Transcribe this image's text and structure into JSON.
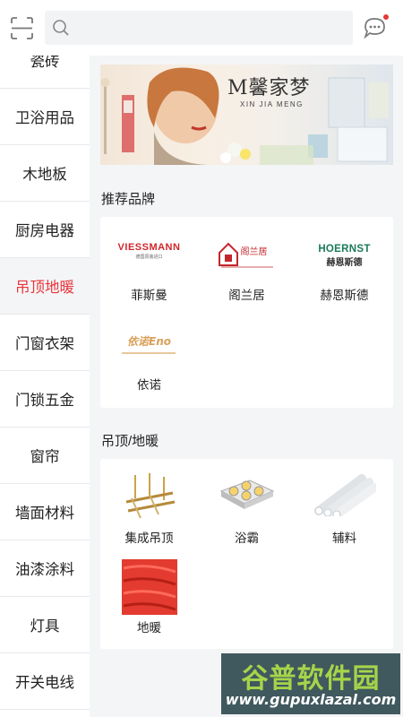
{
  "search": {
    "value": "",
    "placeholder": ""
  },
  "sidebar": {
    "items": [
      {
        "label": "瓷砖",
        "active": false
      },
      {
        "label": "卫浴用品",
        "active": false
      },
      {
        "label": "木地板",
        "active": false
      },
      {
        "label": "厨房电器",
        "active": false
      },
      {
        "label": "吊顶地暖",
        "active": true
      },
      {
        "label": "门窗衣架",
        "active": false
      },
      {
        "label": "门锁五金",
        "active": false
      },
      {
        "label": "窗帘",
        "active": false
      },
      {
        "label": "墙面材料",
        "active": false
      },
      {
        "label": "油漆涂料",
        "active": false
      },
      {
        "label": "灯具",
        "active": false
      },
      {
        "label": "开关电线",
        "active": false
      }
    ]
  },
  "banner": {
    "brand_logo_text": "M馨家梦",
    "brand_latin": "XIN JIA MENG"
  },
  "recommended_brands": {
    "title": "推荐品牌",
    "brands": [
      {
        "name": "菲斯曼",
        "logo": "VIESSMANN",
        "logo_sub": "德国原装进口"
      },
      {
        "name": "阁兰居",
        "logo": "阁兰居",
        "logo_sub": ""
      },
      {
        "name": "赫恩斯德",
        "logo": "HOERNST",
        "logo_cn": "赫恩斯德"
      },
      {
        "name": "依诺",
        "logo": "依诺Eno",
        "logo_sub": ""
      }
    ]
  },
  "category_section": {
    "title": "吊顶/地暖",
    "items": [
      {
        "name": "集成吊顶",
        "icon": "ceiling-frame-image"
      },
      {
        "name": "浴霸",
        "icon": "bath-heater-image"
      },
      {
        "name": "辅料",
        "icon": "pipes-image"
      },
      {
        "name": "地暖",
        "icon": "red-heating-pipe-image"
      }
    ]
  },
  "watermark": {
    "text": "谷普软件园",
    "url": "www.gupuxlazal.com"
  },
  "colors": {
    "accent": "#e8363b",
    "background": "#f4f5f7",
    "viessmann_red": "#d0262c",
    "hoernst_green": "#1a7a5a"
  },
  "icons": [
    "scan-icon",
    "search-icon",
    "message-icon"
  ]
}
